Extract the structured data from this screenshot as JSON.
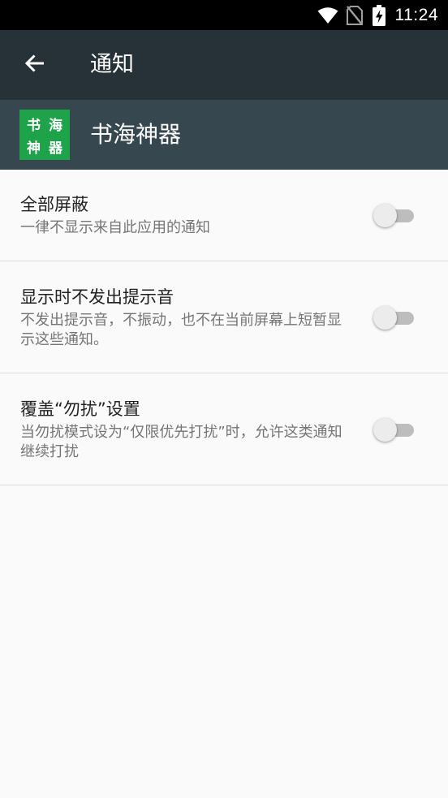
{
  "status_bar": {
    "time": "11:24",
    "icons": [
      "wifi-icon",
      "no-sim-icon",
      "battery-charging-icon"
    ]
  },
  "toolbar": {
    "title": "通知",
    "back_icon": "arrow-back-icon"
  },
  "app": {
    "name": "书海神器",
    "icon_chars": [
      "书",
      "海",
      "神",
      "器"
    ],
    "icon_color": "#1fa34a"
  },
  "settings": [
    {
      "title": "全部屏蔽",
      "summary": "一律不显示来自此应用的通知",
      "enabled": false
    },
    {
      "title": "显示时不发出提示音",
      "summary": "不发出提示音，不振动，也不在当前屏幕上短暂显示这些通知。",
      "enabled": false
    },
    {
      "title": "覆盖“勿扰”设置",
      "summary": "当勿扰模式设为“仅限优先打扰”时，允许这类通知继续打扰",
      "enabled": false
    }
  ],
  "colors": {
    "toolbar_bg": "#263238",
    "app_header_bg": "#37474f",
    "page_bg": "#fafafa"
  }
}
